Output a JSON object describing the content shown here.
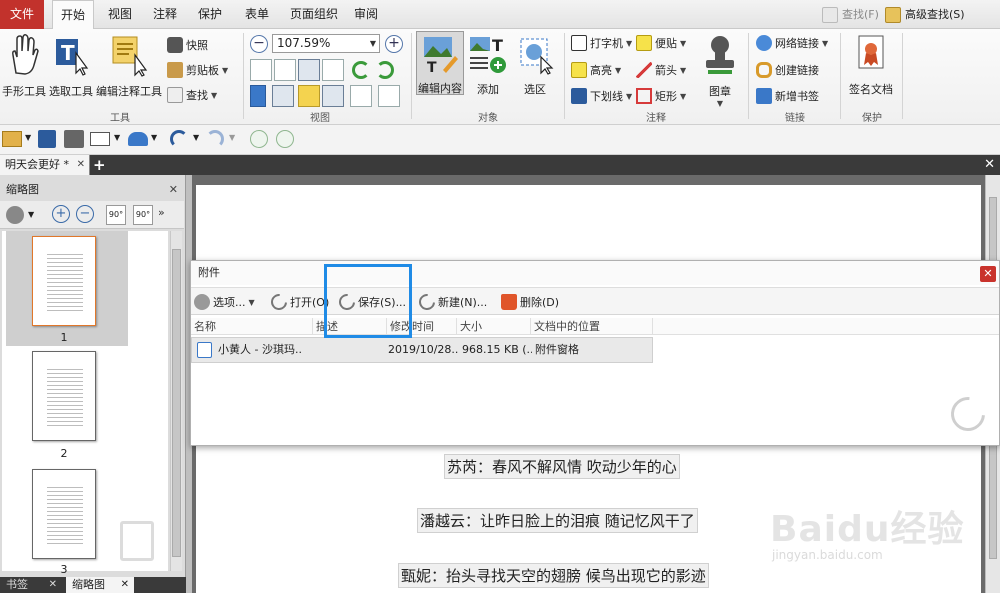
{
  "menubar": {
    "tabs": [
      "文件",
      "开始",
      "视图",
      "注释",
      "保护",
      "表单",
      "页面组织",
      "审阅"
    ],
    "active_tab": "开始",
    "search_label": "查找(F)",
    "advanced_search_label": "高级查找(S)"
  },
  "ribbon": {
    "tools_group": {
      "label": "工具",
      "hand_tool": "手形工具",
      "select_tool": "选取工具",
      "annotate_tool": "编辑注释工具",
      "snapshot": "快照",
      "clipboard": "剪贴板",
      "find": "查找"
    },
    "view_group": {
      "label": "视图",
      "zoom_value": "107.59%"
    },
    "object_group": {
      "label": "对象",
      "edit_content": "编辑内容",
      "add": "添加",
      "select_area": "选区"
    },
    "comment_group": {
      "label": "注释",
      "typewriter": "打字机",
      "note": "便贴",
      "highlight": "高亮",
      "arrow": "箭头",
      "underline": "下划线",
      "rectangle": "矩形",
      "stamp": "图章"
    },
    "link_group": {
      "label": "链接",
      "web_link": "网络链接",
      "create_link": "创建链接",
      "new_bookmark": "新增书签"
    },
    "protect_group": {
      "label": "保护",
      "sign": "签名文档"
    }
  },
  "doc_tab": {
    "title": "明天会更好 *"
  },
  "left_panel": {
    "title": "缩略图",
    "pages": [
      "1",
      "2",
      "3"
    ],
    "bottom_tabs": [
      "书签",
      "缩略图"
    ]
  },
  "attachments": {
    "title": "附件",
    "toolbar": {
      "options": "选项...",
      "open": "打开(O)",
      "save": "保存(S)...",
      "new": "新建(N)...",
      "delete": "删除(D)"
    },
    "columns": [
      "名称",
      "描述",
      "修改时间",
      "大小",
      "文档中的位置"
    ],
    "rows": [
      {
        "name": "小黄人 - 沙琪玛..",
        "description": "",
        "modified": "2019/10/28..",
        "size": "968.15 KB (..",
        "location": "附件窗格"
      }
    ]
  },
  "document": {
    "lines": [
      "苏芮：春风不解风情 吹动少年的心",
      "潘越云：让昨日脸上的泪痕 随记忆风干了",
      "甄妮：抬头寻找天空的翅膀 候鸟出现它的影迹"
    ]
  },
  "watermark": {
    "brand": "Baidu经验",
    "url": "jingyan.baidu.com"
  }
}
